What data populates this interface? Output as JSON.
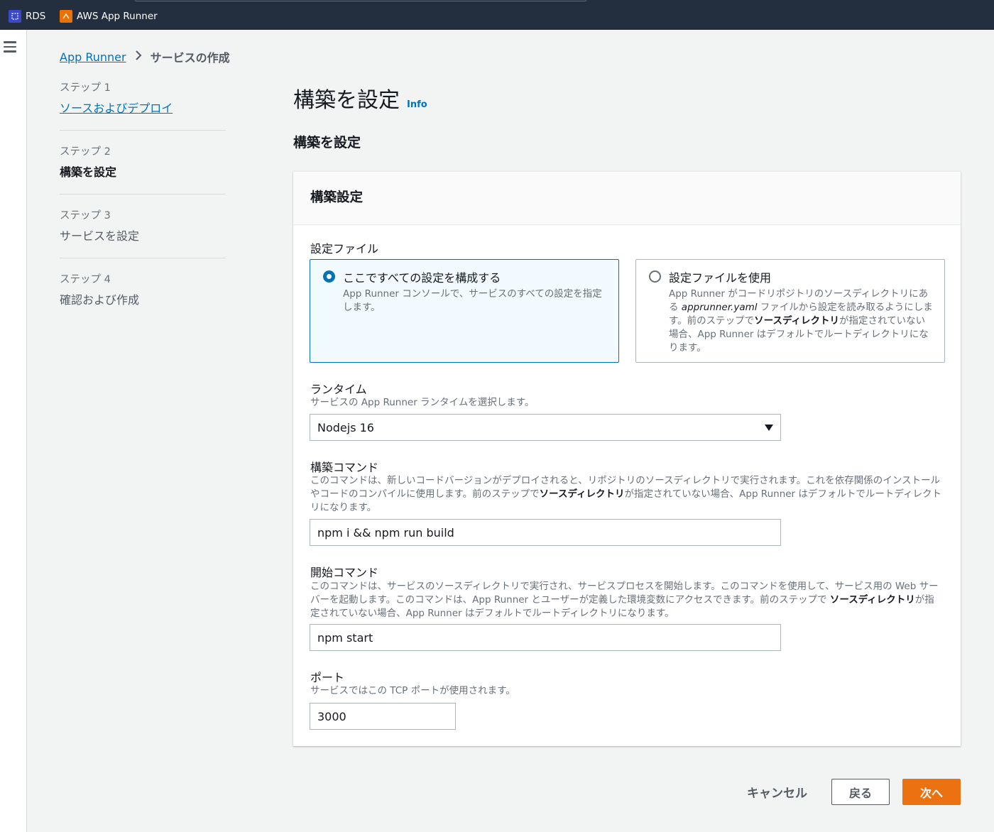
{
  "topbar": {
    "favorites": [
      {
        "label": "RDS",
        "icon": "rds-icon"
      },
      {
        "label": "AWS App Runner",
        "icon": "app-runner-icon"
      }
    ]
  },
  "breadcrumb": {
    "root": "App Runner",
    "current": "サービスの作成"
  },
  "steps": [
    {
      "num": "ステップ 1",
      "label": "ソースおよびデプロイ",
      "state": "link"
    },
    {
      "num": "ステップ 2",
      "label": "構築を設定",
      "state": "active"
    },
    {
      "num": "ステップ 3",
      "label": "サービスを設定",
      "state": "inactive"
    },
    {
      "num": "ステップ 4",
      "label": "確認および作成",
      "state": "inactive"
    }
  ],
  "main": {
    "title": "構築を設定",
    "info": "Info",
    "section_title": "構築を設定"
  },
  "panel": {
    "header": "構築設定",
    "config_file": {
      "label": "設定ファイル",
      "options": [
        {
          "title": "ここですべての設定を構成する",
          "desc": "App Runner コンソールで、サービスのすべての設定を指定します。",
          "selected": true
        },
        {
          "title": "設定ファイルを使用",
          "desc_parts": [
            "App Runner がコードリポジトリのソースディレクトリにある ",
            "apprunner.yaml",
            " ファイルから設定を読み取るようにします。前のステップで",
            "ソースディレクトリ",
            "が指定されていない場合、App Runner はデフォルトでルートディレクトリになります。"
          ],
          "selected": false
        }
      ]
    },
    "runtime": {
      "label": "ランタイム",
      "desc": "サービスの App Runner ランタイムを選択します。",
      "value": "Nodejs 16"
    },
    "build_command": {
      "label": "構築コマンド",
      "desc_parts": [
        "このコマンドは、新しいコードバージョンがデプロイされると、リポジトリのソースディレクトリで実行されます。これを依存関係のインストールやコードのコンパイルに使用します。前のステップで",
        "ソースディレクトリ",
        "が指定されていない場合、App Runner はデフォルトでルートディレクトリになります。"
      ],
      "value": "npm i && npm run build"
    },
    "start_command": {
      "label": "開始コマンド",
      "desc_parts": [
        "このコマンドは、サービスのソースディレクトリで実行され、サービスプロセスを開始します。このコマンドを使用して、サービス用の Web サーバーを起動します。このコマンドは、App Runner とユーザーが定義した環境変数にアクセスできます。前のステップで ",
        "ソースディレクトリ",
        "が指定されていない場合、App Runner はデフォルトでルートディレクトリになります。"
      ],
      "value": "npm start"
    },
    "port": {
      "label": "ポート",
      "desc": "サービスではこの TCP ポートが使用されます。",
      "value": "3000"
    }
  },
  "actions": {
    "cancel": "キャンセル",
    "back": "戻る",
    "next": "次へ"
  },
  "colors": {
    "topbar": "#232f3e",
    "link": "#0073bb",
    "primary": "#ec7211",
    "selected_bg": "#f1faff"
  }
}
